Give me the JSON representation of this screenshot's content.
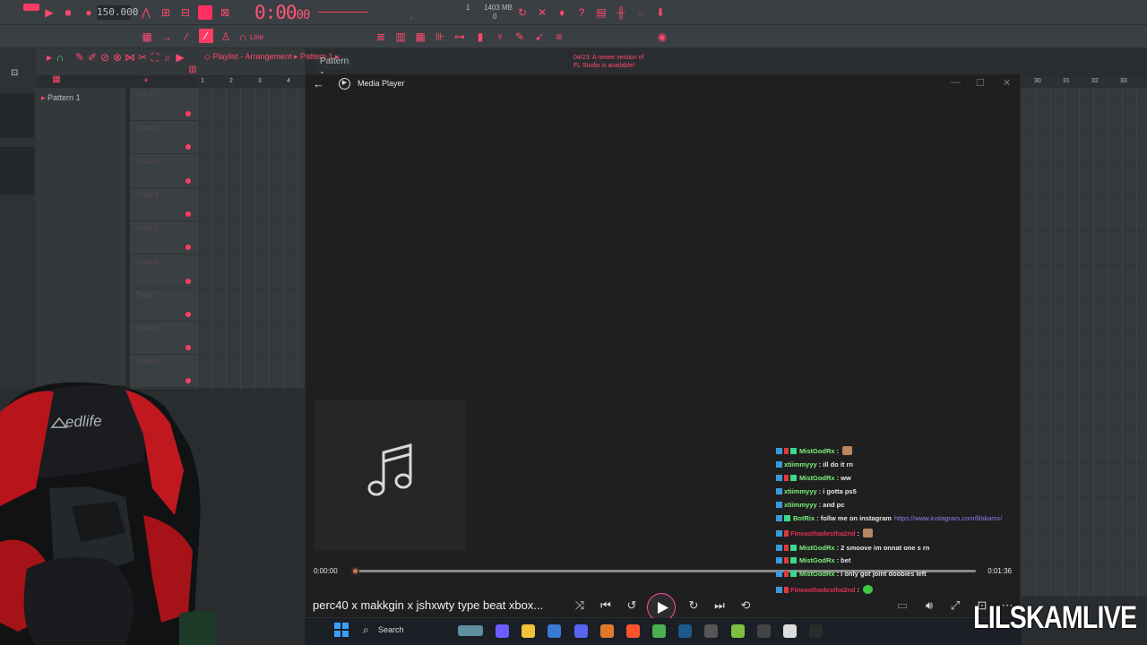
{
  "fl_studio": {
    "tempo": "150.000",
    "time_display": "0:00",
    "time_display_small": "00",
    "cpu_label": "1",
    "memory_label": "1403 MB",
    "memory_sub": "0",
    "pattern_selector": "Pattern 1",
    "snap_label": "Line",
    "update_notice_line1": "04/23: A newer version of",
    "update_notice_line2": "FL Studio is available!",
    "playlist_breadcrumb": "Playlist - Arrangement",
    "playlist_pattern": "Pattern 1",
    "pattern_list_item": "Pattern 1",
    "tracks": [
      "Track 1",
      "Track 2",
      "Track 3",
      "Track 4",
      "Track 5",
      "Track 6",
      "Track 7",
      "Track 8",
      "Track 9",
      "Track 10"
    ],
    "ruler_left": [
      "1",
      "2",
      "3",
      "4"
    ],
    "ruler_right": [
      "30",
      "31",
      "32",
      "33"
    ]
  },
  "media_player": {
    "window_title": "Media Player",
    "current_time": "0:00:00",
    "total_time": "0:01:36",
    "song_title": "perc40 x makkgin x jshxwty type beat xbox...",
    "progress_fraction": 0.0,
    "accent_color": "#ff4aa0"
  },
  "chat": [
    {
      "user": "MistGodRx",
      "message": ":",
      "emote": true,
      "user_color": "green"
    },
    {
      "user": "xtiimmyyy",
      "message": ": ill do it rn",
      "user_color": "green"
    },
    {
      "user": "MistGodRx",
      "message": ": ww",
      "user_color": "green"
    },
    {
      "user": "xtiimmyyy",
      "message": ": i gotta ps5",
      "user_color": "green"
    },
    {
      "user": "xtiimmyyy",
      "message": ": and pc",
      "user_color": "green"
    },
    {
      "user": "BotRix",
      "message": ": follw me on instagram",
      "link": "https://www.instagram.com/lilskamx/",
      "user_color": "green"
    },
    {
      "user": "Fineasthadestha2nd",
      "message": ":",
      "emote": true,
      "user_color": "red"
    },
    {
      "user": "MistGodRx",
      "message": ": 2 smoove im onnat one s rn",
      "user_color": "green"
    },
    {
      "user": "MistGodRx",
      "message": ": bet",
      "user_color": "green"
    },
    {
      "user": "MistGodRx",
      "message": ": i only got joint doobies left",
      "user_color": "green"
    },
    {
      "user": "Fineasthadestha2nd",
      "message": ":",
      "emote": true,
      "emote_green": true,
      "user_color": "red"
    }
  ],
  "taskbar": {
    "search_label": "Search"
  },
  "chair_brand": "edlife",
  "watermark": "LILSKAMLIVE"
}
